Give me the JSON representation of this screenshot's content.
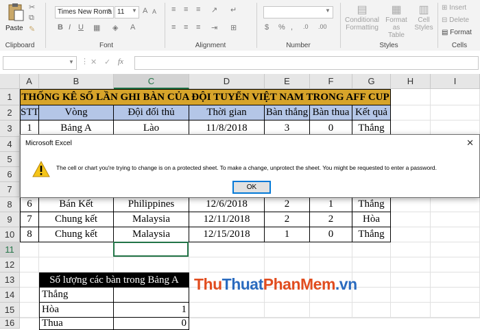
{
  "ribbon": {
    "clipboard": {
      "paste": "Paste",
      "label": "Clipboard"
    },
    "font": {
      "name": "Times New Roma",
      "size": "11",
      "label": "Font"
    },
    "alignment": {
      "label": "Alignment"
    },
    "number": {
      "label": "Number"
    },
    "styles": {
      "conditional": "Conditional",
      "formatting": "Formatting",
      "format_as": "Format as",
      "table": "Table",
      "cell": "Cell",
      "styles_btn": "Styles",
      "label": "Styles"
    },
    "cells": {
      "insert": "Insert",
      "delete": "Delete",
      "format": "Format",
      "label": "Cells"
    }
  },
  "formula_bar": {
    "name_box": "",
    "fx": "fx",
    "content": ""
  },
  "columns": [
    "A",
    "B",
    "C",
    "D",
    "E",
    "F",
    "G",
    "H",
    "I"
  ],
  "rows": [
    "1",
    "2",
    "3",
    "4",
    "5",
    "6",
    "7",
    "8",
    "9",
    "10",
    "11",
    "12",
    "13",
    "14",
    "15",
    "16"
  ],
  "selected_column": "C",
  "selected_row": "11",
  "table": {
    "title": "THỐNG KÊ SỐ LẦN GHI BÀN CỦA ĐỘI TUYỂN VIỆT NAM TRONG AFF CUP",
    "title_bg": "#d7a42a",
    "header_bg": "#b4c6e7",
    "headers": [
      "STT",
      "Vòng",
      "Đội đối thủ",
      "Thời gian",
      "Bàn thắng",
      "Bàn thua",
      "Kết quả"
    ],
    "row3": [
      "1",
      "Bảng A",
      "Lào",
      "11/8/2018",
      "3",
      "0",
      "Thắng"
    ],
    "row8": [
      "6",
      "Bán Kết",
      "Philippines",
      "12/6/2018",
      "2",
      "1",
      "Thắng"
    ],
    "row9": [
      "7",
      "Chung kết",
      "Malaysia",
      "12/11/2018",
      "2",
      "2",
      "Hòa"
    ],
    "row10": [
      "8",
      "Chung kết",
      "Malaysia",
      "12/15/2018",
      "1",
      "0",
      "Thắng"
    ]
  },
  "summary": {
    "title": "Số lượng các bàn trong Bảng A",
    "rows": [
      {
        "label": "Thắng",
        "value": ""
      },
      {
        "label": "Hòa",
        "value": "1"
      },
      {
        "label": "Thua",
        "value": "0"
      }
    ]
  },
  "dialog": {
    "title": "Microsoft Excel",
    "message": "The cell or chart you're trying to change is on a protected sheet. To make a change, unprotect the sheet. You might be requested to enter a password.",
    "ok": "OK",
    "close": "✕",
    "icon": "warning-icon"
  },
  "watermark": {
    "part1": "Thu",
    "part2": "Thuat",
    "part3": "PhanMem",
    "part4": ".vn"
  },
  "colors": {
    "excel_green": "#217346",
    "dialog_accent": "#0078d7"
  }
}
